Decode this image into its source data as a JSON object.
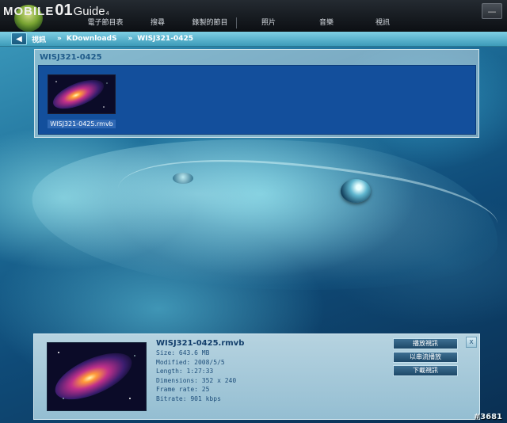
{
  "app": {
    "logo_left": "MOBILE",
    "logo_mid": "01",
    "logo_right": "Guide",
    "logo_sup": "4"
  },
  "nav": {
    "items": [
      {
        "label": "電子節目表"
      },
      {
        "label": "搜尋"
      },
      {
        "label": "錄製的節目"
      },
      {
        "label": "照片"
      },
      {
        "label": "音樂"
      },
      {
        "label": "視訊"
      }
    ]
  },
  "breadcrumb": {
    "root": "視訊",
    "sep": "»",
    "folder": "KDownloadS",
    "current": "WISJ321-0425"
  },
  "folder": {
    "title": "WISJ321-0425",
    "items": [
      {
        "label": "WISJ321-0425.rmvb"
      }
    ]
  },
  "details": {
    "filename": "WISJ321-0425.rmvb",
    "size": "Size: 643.6 MB",
    "modified": "Modified: 2008/5/5",
    "length": "Length: 1:27:33",
    "dimensions": "Dimensions: 352 x 240",
    "frame_rate": "Frame rate: 25",
    "bitrate": "Bitrate: 901 kbps",
    "actions": {
      "play": "播放視訊",
      "stream": "以串流播放",
      "download": "下載視訊"
    },
    "close": "x"
  },
  "watermark": "#3681",
  "colors": {
    "accent": "#3d9bb9",
    "folder_bg": "#134f9c"
  }
}
